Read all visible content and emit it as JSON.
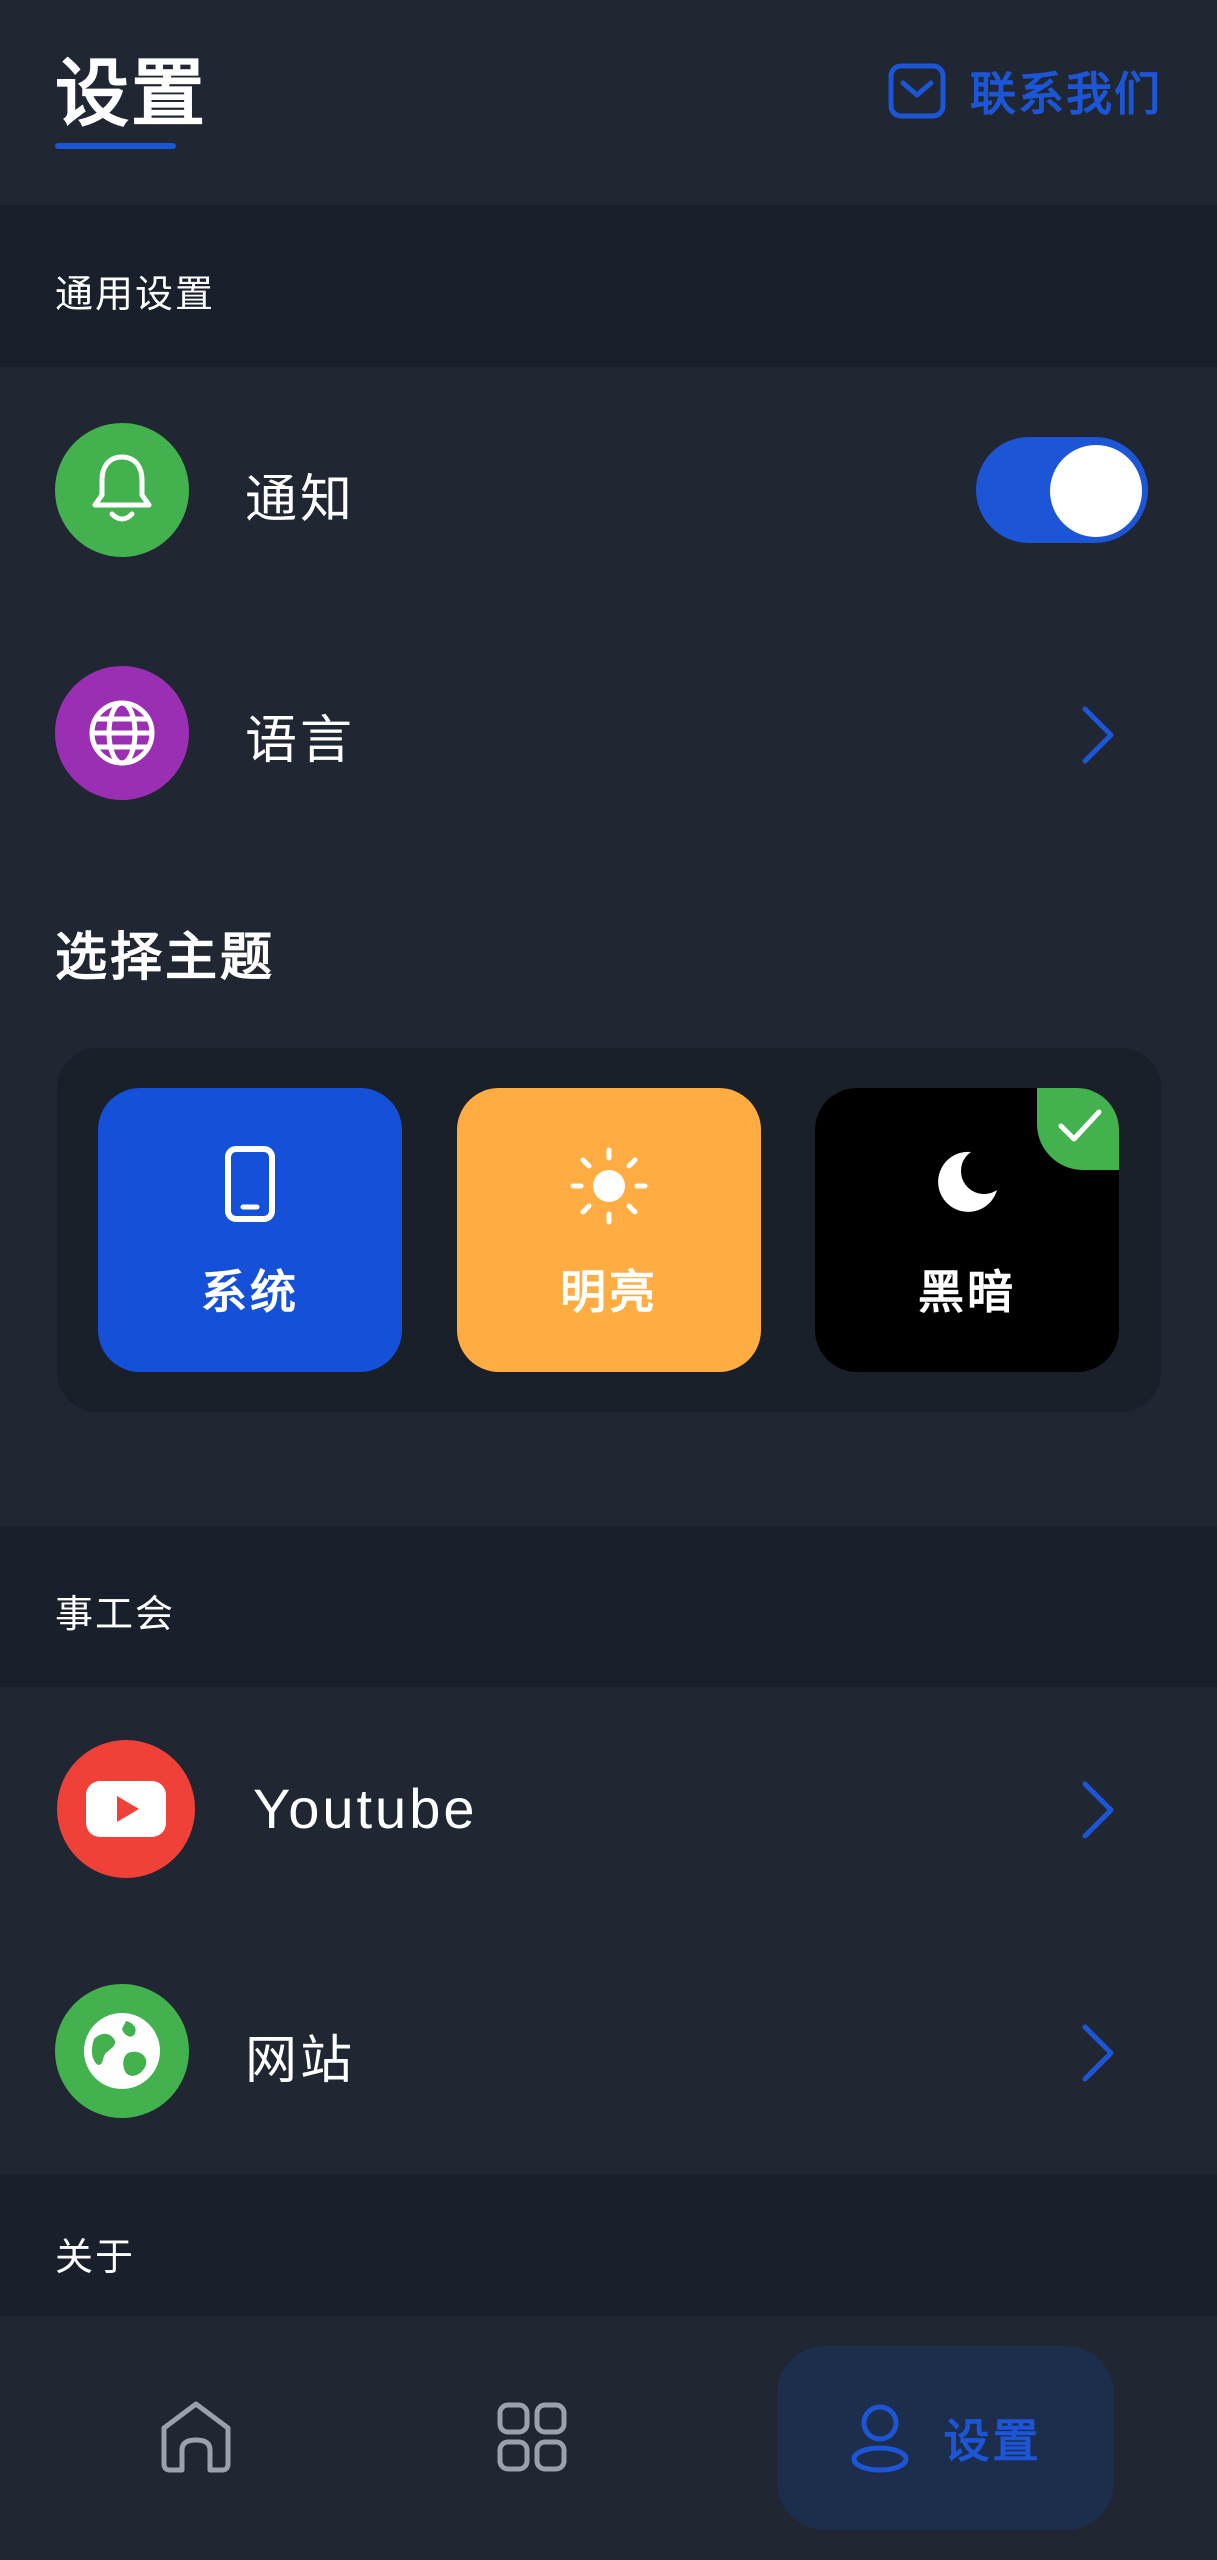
{
  "header": {
    "title": "设置",
    "contact_label": "联系我们",
    "contact_icon": "mail-icon"
  },
  "sections": {
    "general": "通用设置",
    "union": "事工会",
    "about": "关于"
  },
  "general_items": [
    {
      "label": "通知",
      "icon": "bell-icon",
      "icon_bg": "#44b14f",
      "control": "toggle",
      "toggle_on": true
    },
    {
      "label": "语言",
      "icon": "globe-icon",
      "icon_bg": "#9b2fb4",
      "control": "chevron"
    }
  ],
  "theme": {
    "title": "选择主题",
    "options": [
      {
        "label": "系统",
        "icon": "phone-icon",
        "bg": "#1550d8",
        "selected": false
      },
      {
        "label": "明亮",
        "icon": "sun-icon",
        "bg": "#ffac42",
        "selected": false
      },
      {
        "label": "黑暗",
        "icon": "moon-icon",
        "bg": "#000000",
        "selected": true
      }
    ]
  },
  "union_items": [
    {
      "label": "Youtube",
      "icon": "youtube-icon",
      "icon_bg": "#ef4138",
      "control": "chevron"
    },
    {
      "label": "网站",
      "icon": "earth-icon",
      "icon_bg": "#44b14f",
      "control": "chevron"
    }
  ],
  "bottom_nav": {
    "items": [
      {
        "name": "home",
        "icon": "home-icon"
      },
      {
        "name": "apps",
        "icon": "grid-icon"
      },
      {
        "name": "settings",
        "icon": "user-icon",
        "label": "设置",
        "active": true
      }
    ]
  },
  "colors": {
    "accent": "#1c55d6",
    "background": "#202733",
    "section_band": "#1a202b",
    "selected_check": "#44b14f"
  }
}
